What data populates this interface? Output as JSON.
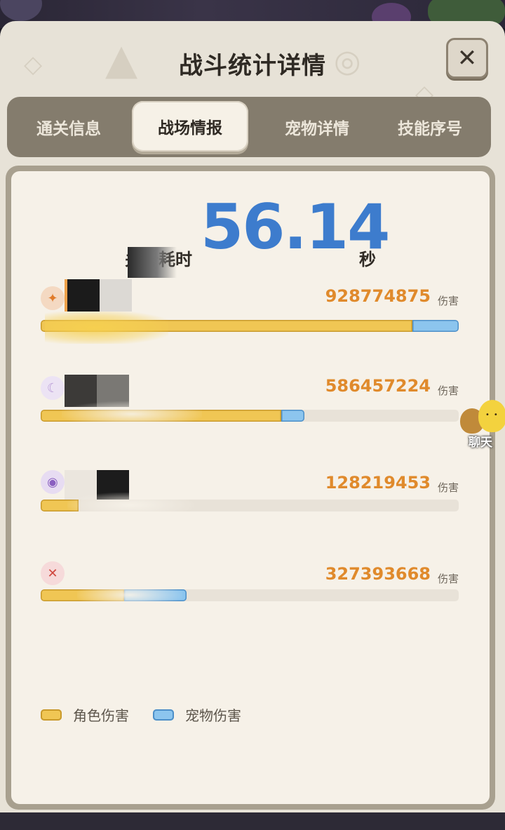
{
  "window": {
    "title": "战斗统计详情",
    "close_icon": "close-icon"
  },
  "tabs": [
    {
      "label": "通关信息",
      "active": false
    },
    {
      "label": "战场情报",
      "active": true
    },
    {
      "label": "宠物详情",
      "active": false
    },
    {
      "label": "技能序号",
      "active": false
    }
  ],
  "summary": {
    "time_label": "关卡耗时",
    "time_value": "56.14",
    "time_unit": "秒"
  },
  "players": [
    {
      "icon": "claw-icon",
      "name_hint": "",
      "damage": "928774875",
      "damage_unit": "伤害",
      "role_fraction": 0.89,
      "pet_fraction": 0.11
    },
    {
      "icon": "swirl-icon",
      "name_hint": "",
      "damage": "586457224",
      "damage_unit": "伤害",
      "role_fraction": 0.575,
      "pet_fraction": 0.055
    },
    {
      "icon": "orb-icon",
      "name_hint": "",
      "damage": "128219453",
      "damage_unit": "伤害",
      "role_fraction": 0.09,
      "pet_fraction": 0.0
    },
    {
      "icon": "fox-icon",
      "name_hint": "",
      "damage": "327393668",
      "damage_unit": "伤害",
      "role_fraction": 0.2,
      "pet_fraction": 0.15
    }
  ],
  "legend": {
    "role_label": "角色伤害",
    "pet_label": "宠物伤害"
  },
  "colors": {
    "role_bar": "#f0c654",
    "pet_bar": "#8cc5ee",
    "damage_text": "#e08a2c",
    "time_text": "#3d7ccd"
  },
  "chat_widget": {
    "label": "聊天"
  }
}
